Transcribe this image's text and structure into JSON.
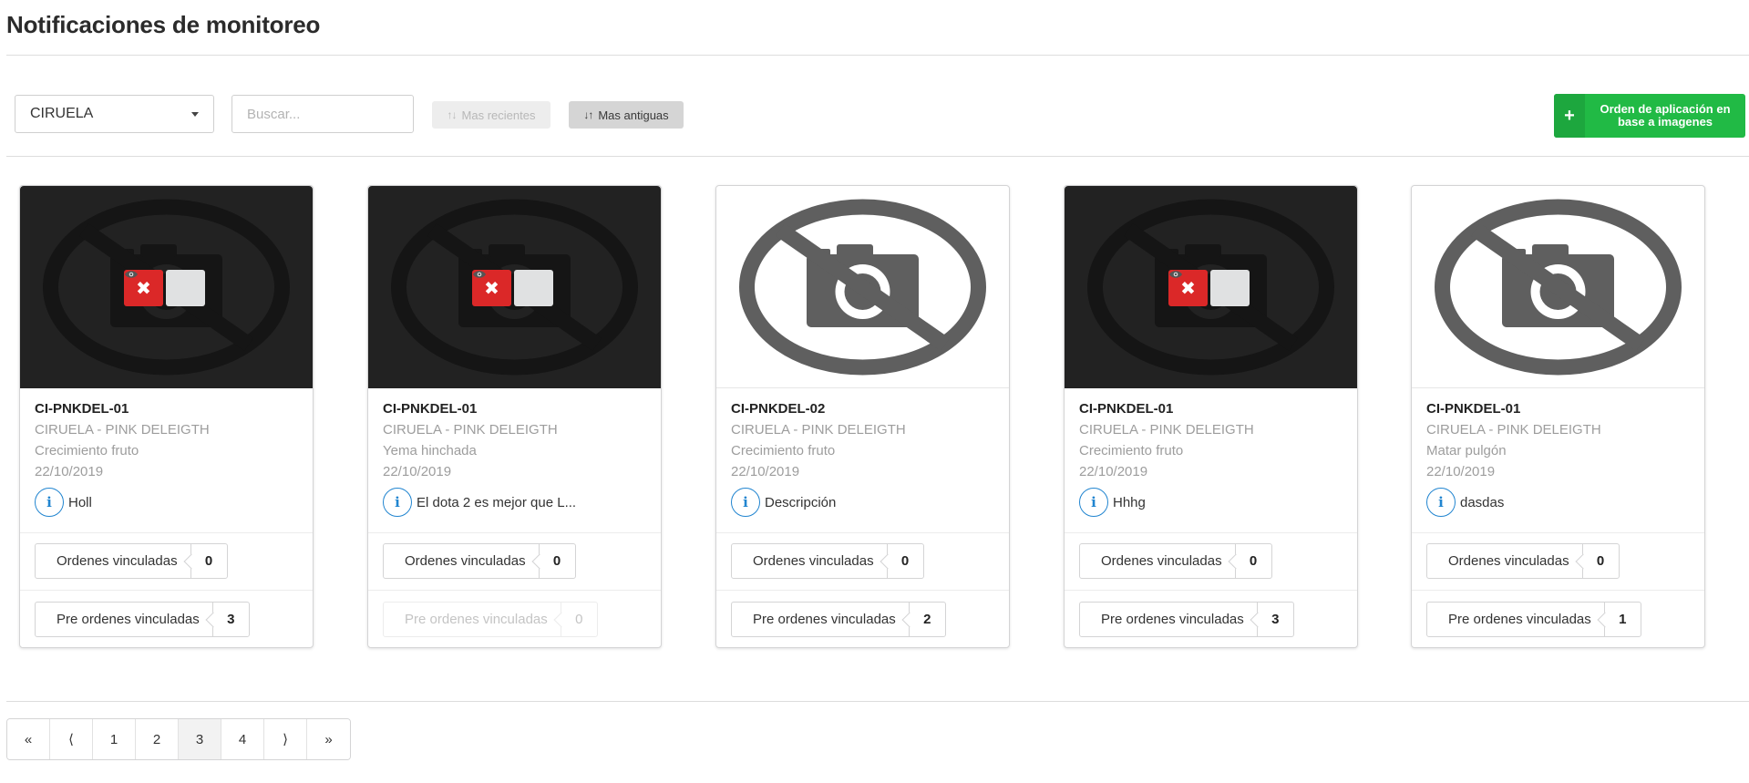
{
  "page": {
    "title": "Notificaciones de monitoreo"
  },
  "toolbar": {
    "species_select": {
      "value": "CIRUELA"
    },
    "search": {
      "placeholder": "Buscar..."
    },
    "sort_recent": {
      "label": "Mas recientes",
      "enabled": false
    },
    "sort_oldest": {
      "label": "Mas antiguas",
      "active": true
    },
    "order_button": {
      "label": "Orden de aplicación en base a imagenes",
      "color": "#21ba45"
    }
  },
  "cards": [
    {
      "code": "CI-PNKDEL-01",
      "variety": "CIRUELA - PINK DELEIGTH",
      "stage": "Crecimiento fruto",
      "date": "22/10/2019",
      "note": "Holl",
      "image_style": "dark",
      "image_actions": true,
      "linked_orders": {
        "label": "Ordenes vinculadas",
        "count": "0"
      },
      "linked_preorders": {
        "label": "Pre ordenes vinculadas",
        "count": "3",
        "disabled": false
      }
    },
    {
      "code": "CI-PNKDEL-01",
      "variety": "CIRUELA - PINK DELEIGTH",
      "stage": "Yema hinchada",
      "date": "22/10/2019",
      "note": "El dota 2 es mejor que L...",
      "image_style": "dark",
      "image_actions": true,
      "linked_orders": {
        "label": "Ordenes vinculadas",
        "count": "0"
      },
      "linked_preorders": {
        "label": "Pre ordenes vinculadas",
        "count": "0",
        "disabled": true
      }
    },
    {
      "code": "CI-PNKDEL-02",
      "variety": "CIRUELA - PINK DELEIGTH",
      "stage": "Crecimiento fruto",
      "date": "22/10/2019",
      "note": "Descripción",
      "image_style": "light",
      "image_actions": false,
      "linked_orders": {
        "label": "Ordenes vinculadas",
        "count": "0"
      },
      "linked_preorders": {
        "label": "Pre ordenes vinculadas",
        "count": "2",
        "disabled": false
      }
    },
    {
      "code": "CI-PNKDEL-01",
      "variety": "CIRUELA - PINK DELEIGTH",
      "stage": "Crecimiento fruto",
      "date": "22/10/2019",
      "note": "Hhhg",
      "image_style": "dark",
      "image_actions": true,
      "linked_orders": {
        "label": "Ordenes vinculadas",
        "count": "0"
      },
      "linked_preorders": {
        "label": "Pre ordenes vinculadas",
        "count": "3",
        "disabled": false
      }
    },
    {
      "code": "CI-PNKDEL-01",
      "variety": "CIRUELA - PINK DELEIGTH",
      "stage": "Matar pulgón",
      "date": "22/10/2019",
      "note": "dasdas",
      "image_style": "light",
      "image_actions": false,
      "linked_orders": {
        "label": "Ordenes vinculadas",
        "count": "0"
      },
      "linked_preorders": {
        "label": "Pre ordenes vinculadas",
        "count": "1",
        "disabled": false
      }
    }
  ],
  "pagination": {
    "first": "«",
    "prev": "⟨",
    "next": "⟩",
    "last": "»",
    "pages": [
      "1",
      "2",
      "3",
      "4"
    ],
    "current": "3"
  },
  "icons": {
    "image_placeholder": "no-camera-icon",
    "delete": "close-icon",
    "view": "eye-icon",
    "info": "info-icon",
    "add": "plus-icon",
    "sort": "sort-icon",
    "dropdown": "chevron-down-icon"
  },
  "colors": {
    "danger": "#db2828",
    "info": "#2185d0",
    "success": "#21ba45",
    "dark_image_bg": "#222222"
  }
}
